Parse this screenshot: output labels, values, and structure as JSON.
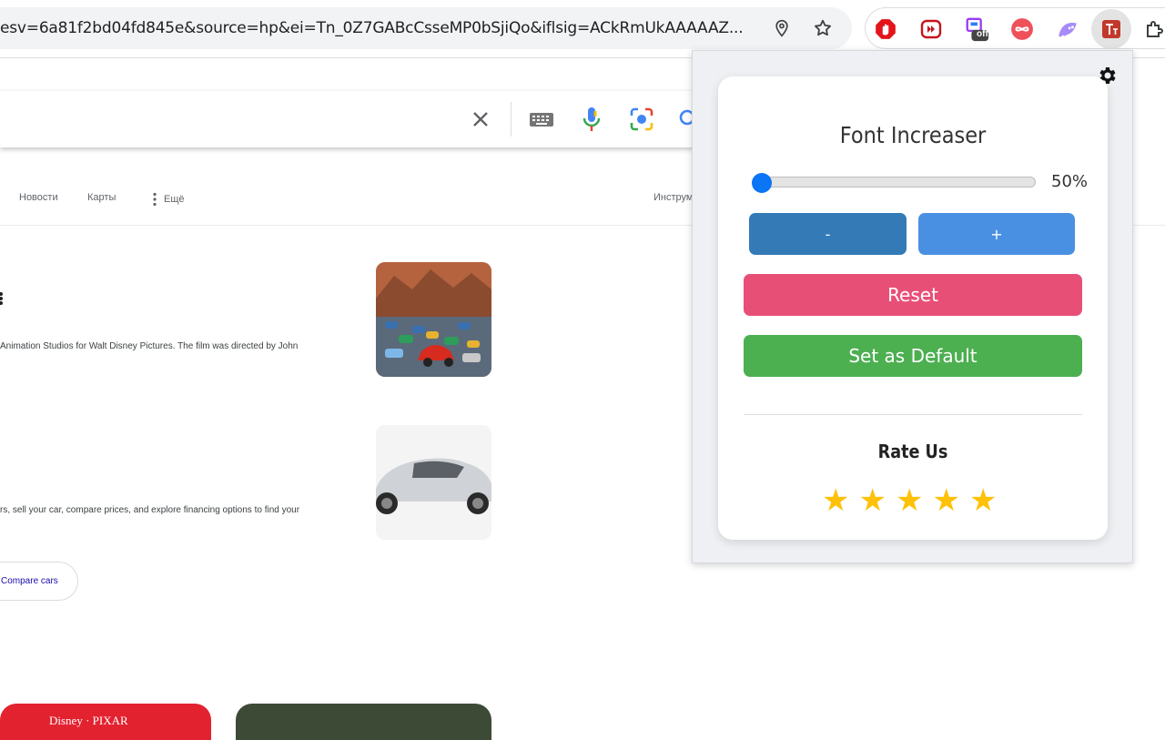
{
  "browser": {
    "url": "esv=6a81f2bd04fd845e&source=hp&ei=Tn_0Z7GABcCsseMP0bSjiQo&iflsig=ACkRmUkAAAAAZ...",
    "ext_off_badge": "off"
  },
  "google": {
    "tabs": [
      "Новости",
      "Карты",
      "Ещё",
      "Инструм"
    ],
    "result1_snippet": "Animation Studios for Walt Disney Pictures. The film was directed by John",
    "result2_snippet": "rs, sell your car, compare prices, and explore financing options to find your",
    "chip_label": "Compare cars",
    "bottom_card_logo": "Disney · PIXAR"
  },
  "popup": {
    "title": "Font Increaser",
    "slider_value_label": "50%",
    "slider_fraction": 0.0,
    "minus_label": "-",
    "plus_label": "+",
    "reset_label": "Reset",
    "default_label": "Set as Default",
    "rate_title": "Rate Us",
    "stars": [
      "★",
      "★",
      "★",
      "★",
      "★"
    ],
    "star_color": "#ffc107"
  }
}
